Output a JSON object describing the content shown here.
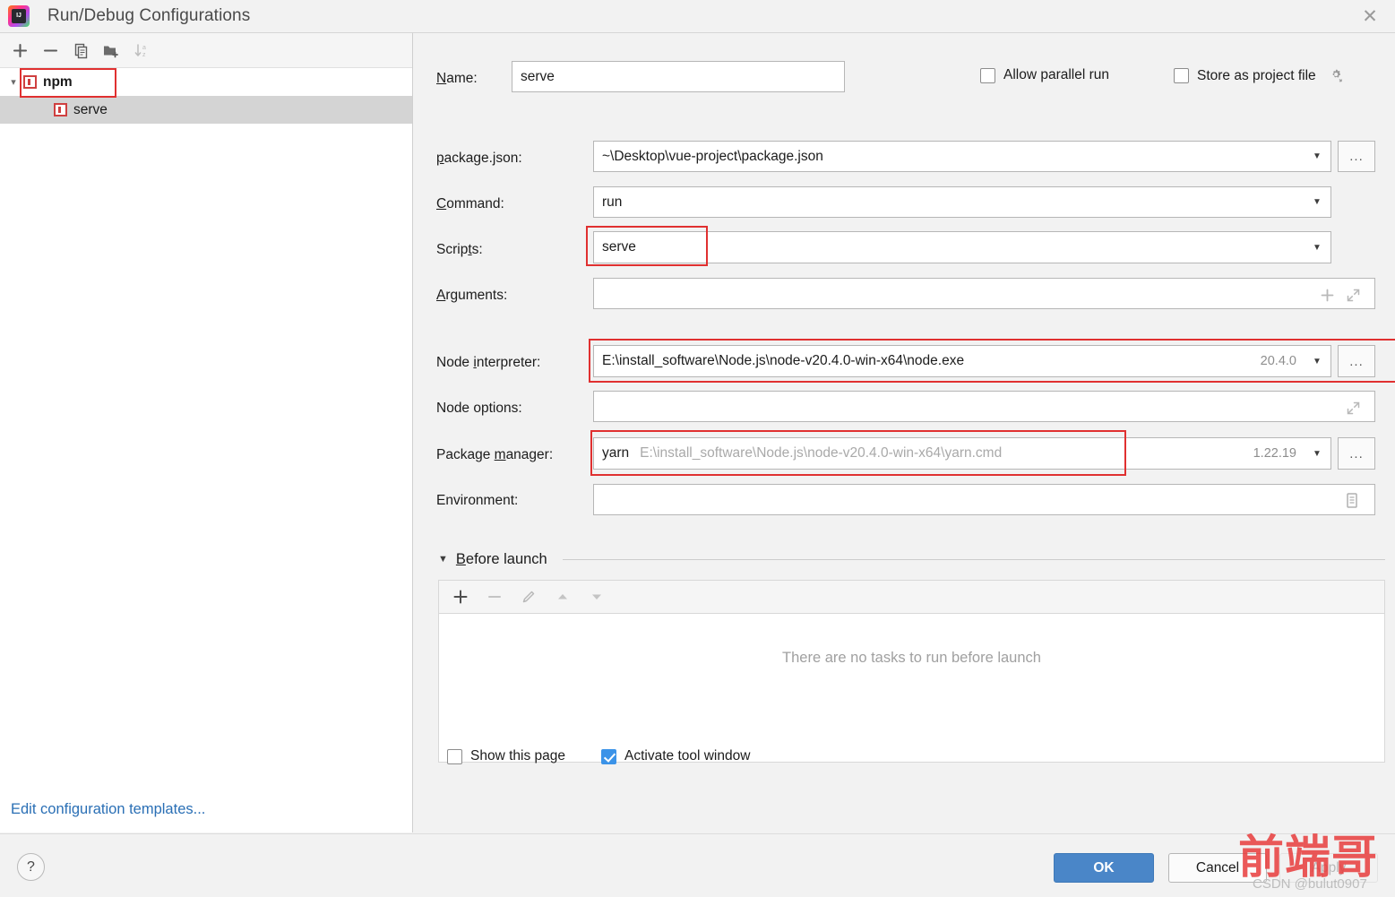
{
  "window": {
    "title": "Run/Debug Configurations",
    "logo_icon": "intellij-idea-logo-icon",
    "logo_text": "IJ",
    "close_icon": "close-icon",
    "close_glyph": "✕"
  },
  "left_panel": {
    "toolbar": [
      {
        "name": "add-configuration-button",
        "icon": "plus-icon"
      },
      {
        "name": "remove-configuration-button",
        "icon": "minus-icon"
      },
      {
        "name": "copy-configuration-button",
        "icon": "copy-icon"
      },
      {
        "name": "new-folder-button",
        "icon": "new-folder-icon"
      },
      {
        "name": "sort-configurations-button",
        "icon": "sort-alphabetically-icon"
      }
    ],
    "tree": [
      {
        "label": "npm",
        "icon": "npm-icon",
        "bold": true,
        "expanded": true,
        "selected": false,
        "indent": 0
      },
      {
        "label": "serve",
        "icon": "npm-icon",
        "bold": false,
        "expanded": false,
        "selected": true,
        "indent": 1
      }
    ],
    "edit_templates_link": "Edit configuration templates..."
  },
  "form": {
    "name": {
      "label": "Name:",
      "mnemonic": "N",
      "value": "serve"
    },
    "allow_parallel_run": {
      "label": "Allow parallel run",
      "checked": false
    },
    "store_as_project_file": {
      "label": "Store as project file",
      "checked": false,
      "gear_icon": "gear-icon"
    },
    "package_json": {
      "label": "package.json:",
      "value": "~\\Desktop\\vue-project\\package.json",
      "browse_label": "...",
      "dropdown_icon": "chevron-down-icon"
    },
    "command": {
      "label": "Command:",
      "value": "run",
      "dropdown_icon": "chevron-down-icon"
    },
    "scripts": {
      "label": "Scripts:",
      "value": "serve",
      "dropdown_icon": "chevron-down-icon",
      "highlighted": true
    },
    "arguments": {
      "label": "Arguments:",
      "value": "",
      "placeholder": "",
      "add_icon": "plus-icon",
      "expand_icon": "expand-icon"
    },
    "node_interpreter": {
      "label": "Node interpreter:",
      "value": "E:\\install_software\\Node.js\\node-v20.4.0-win-x64\\node.exe",
      "version": "20.4.0",
      "browse_label": "...",
      "dropdown_icon": "chevron-down-icon",
      "highlighted": true
    },
    "node_options": {
      "label": "Node options:",
      "value": "",
      "expand_icon": "expand-icon"
    },
    "package_manager": {
      "label": "Package manager:",
      "value_name": "yarn",
      "value_path": "E:\\install_software\\Node.js\\node-v20.4.0-win-x64\\yarn.cmd",
      "version": "1.22.19",
      "browse_label": "...",
      "dropdown_icon": "chevron-down-icon",
      "highlighted": true
    },
    "environment": {
      "label": "Environment:",
      "value": "",
      "editor_icon": "environment-variables-icon"
    }
  },
  "before_launch": {
    "title": "Before launch",
    "collapse_icon": "triangle-down-icon",
    "toolbar": [
      {
        "name": "add-task-button",
        "icon": "plus-icon",
        "enabled": true
      },
      {
        "name": "remove-task-button",
        "icon": "minus-icon",
        "enabled": false
      },
      {
        "name": "edit-task-button",
        "icon": "pencil-icon",
        "enabled": false
      },
      {
        "name": "move-task-up-button",
        "icon": "arrow-up-icon",
        "enabled": false
      },
      {
        "name": "move-task-down-button",
        "icon": "arrow-down-icon",
        "enabled": false
      }
    ],
    "empty_text": "There are no tasks to run before launch",
    "show_this_page": {
      "label": "Show this page",
      "checked": false
    },
    "activate_tool_window": {
      "label": "Activate tool window",
      "checked": true
    }
  },
  "bottom_bar": {
    "help_label": "?",
    "ok_label": "OK",
    "cancel_label": "Cancel",
    "apply_label": "Apply"
  },
  "watermark": {
    "text": "前端哥",
    "subtext": "CSDN @bulut0907"
  },
  "colors": {
    "accent": "#4a86c8",
    "annotation": "#e03030",
    "link": "#2a6fb5",
    "checkbox_checked": "#3b93e8",
    "panel_bg": "#f2f2f2",
    "field_bg": "#ffffff"
  }
}
